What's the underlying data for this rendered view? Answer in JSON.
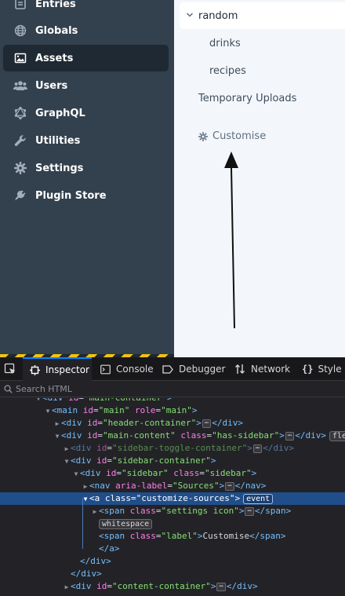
{
  "sidebar": {
    "items": [
      {
        "label": "Entries",
        "icon": "entries-icon"
      },
      {
        "label": "Globals",
        "icon": "globe-icon"
      },
      {
        "label": "Assets",
        "icon": "image-icon",
        "active": true
      },
      {
        "label": "Users",
        "icon": "users-icon"
      },
      {
        "label": "GraphQL",
        "icon": "graphql-icon"
      },
      {
        "label": "Utilities",
        "icon": "wrench-icon"
      },
      {
        "label": "Settings",
        "icon": "gear-icon"
      },
      {
        "label": "Plugin Store",
        "icon": "plug-icon"
      }
    ]
  },
  "sources": {
    "folder": "random",
    "children": [
      "drinks",
      "recipes"
    ],
    "temporary": "Temporary Uploads",
    "customise": "Customise"
  },
  "devtools": {
    "tabs": [
      "Inspector",
      "Console",
      "Debugger",
      "Network",
      "Style E"
    ],
    "search_placeholder": "Search HTML",
    "tree": [
      {
        "t": "div",
        "attrs": [
          [
            "id",
            "main-container"
          ]
        ],
        "text": ">"
      },
      {
        "t": "main",
        "attrs": [
          [
            "id",
            "main"
          ],
          [
            "role",
            "main"
          ]
        ],
        "text": ">"
      },
      {
        "t": "div",
        "attrs": [
          [
            "id",
            "header-container"
          ]
        ],
        "close": "div"
      },
      {
        "t": "div",
        "attrs": [
          [
            "id",
            "main-content"
          ],
          [
            "class",
            "has-sidebar"
          ]
        ],
        "close": "div",
        "badge": "flex"
      },
      {
        "t": "div",
        "attrs": [
          [
            "id",
            "sidebar-toggle-container"
          ]
        ],
        "close": "div"
      },
      {
        "t": "div",
        "attrs": [
          [
            "id",
            "sidebar-container"
          ]
        ],
        "text": ">"
      },
      {
        "t": "div",
        "attrs": [
          [
            "id",
            "sidebar"
          ],
          [
            "class",
            "sidebar"
          ]
        ],
        "text": ">"
      },
      {
        "t": "nav",
        "attrs": [
          [
            "aria-label",
            "Sources"
          ]
        ],
        "close": "nav"
      },
      {
        "t": "a",
        "attrs": [
          [
            "class",
            "customize-sources"
          ]
        ],
        "text": ">",
        "badge": "event"
      },
      {
        "t": "span",
        "attrs": [
          [
            "class",
            "settings icon"
          ]
        ],
        "close": "span"
      },
      {
        "badge": "whitespace"
      },
      {
        "t": "span",
        "attrs": [
          [
            "class",
            "label"
          ]
        ],
        "inner": "Customise",
        "close": "span"
      },
      {
        "close": "a"
      },
      {
        "close": "div"
      },
      {
        "close": "div"
      },
      {
        "t": "div",
        "attrs": [
          [
            "id",
            "content-container"
          ]
        ],
        "close": "div"
      }
    ]
  },
  "colors": {
    "sidebar_bg": "#33404d",
    "active_item_bg": "#1f2933",
    "selection_bg": "#204e8a",
    "devtools_bg": "#232327",
    "tag": "#75bfff",
    "attr_name": "#ff7de9",
    "attr_value": "#86de74"
  }
}
